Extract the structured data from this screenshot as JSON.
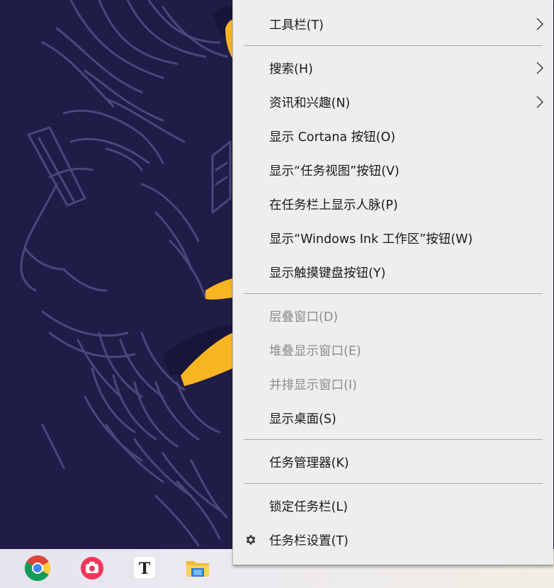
{
  "context_menu": {
    "items": [
      {
        "label": "工具栏(T)",
        "has_submenu": true,
        "disabled": false
      },
      {
        "label": "搜索(H)",
        "has_submenu": true,
        "disabled": false
      },
      {
        "label": "资讯和兴趣(N)",
        "has_submenu": true,
        "disabled": false
      },
      {
        "label": "显示 Cortana 按钮(O)",
        "has_submenu": false,
        "disabled": false
      },
      {
        "label": "显示“任务视图”按钮(V)",
        "has_submenu": false,
        "disabled": false
      },
      {
        "label": "在任务栏上显示人脉(P)",
        "has_submenu": false,
        "disabled": false
      },
      {
        "label": "显示“Windows Ink 工作区”按钮(W)",
        "has_submenu": false,
        "disabled": false
      },
      {
        "label": "显示触摸键盘按钮(Y)",
        "has_submenu": false,
        "disabled": false
      },
      {
        "label": "层叠窗口(D)",
        "has_submenu": false,
        "disabled": true
      },
      {
        "label": "堆叠显示窗口(E)",
        "has_submenu": false,
        "disabled": true
      },
      {
        "label": "并排显示窗口(I)",
        "has_submenu": false,
        "disabled": true
      },
      {
        "label": "显示桌面(S)",
        "has_submenu": false,
        "disabled": false
      },
      {
        "label": "任务管理器(K)",
        "has_submenu": false,
        "disabled": false
      },
      {
        "label": "锁定任务栏(L)",
        "has_submenu": false,
        "disabled": false
      },
      {
        "label": "任务栏设置(T)",
        "has_submenu": false,
        "disabled": false,
        "icon": "gear-icon"
      }
    ]
  },
  "taskbar": {
    "apps": [
      {
        "name": "chrome-icon"
      },
      {
        "name": "camera-app-icon"
      },
      {
        "name": "text-editor-icon",
        "glyph": "T"
      },
      {
        "name": "file-explorer-icon"
      }
    ]
  },
  "colors": {
    "wallpaper": "#1f1c47",
    "wallpaper_lines": "#4a4878",
    "accent_yellow": "#f8b522",
    "menu_bg": "#eeeeee",
    "disabled_text": "#8c8c8c"
  }
}
